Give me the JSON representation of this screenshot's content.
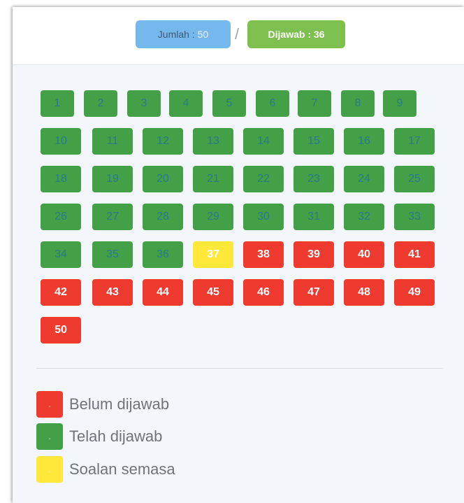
{
  "header": {
    "total_label": "Jumlah : ",
    "total_value": "50",
    "separator": "/",
    "answered_label": "Dijawab : 36"
  },
  "questions": [
    {
      "n": "1",
      "s": "answered"
    },
    {
      "n": "2",
      "s": "answered"
    },
    {
      "n": "3",
      "s": "answered"
    },
    {
      "n": "4",
      "s": "answered"
    },
    {
      "n": "5",
      "s": "answered"
    },
    {
      "n": "6",
      "s": "answered"
    },
    {
      "n": "7",
      "s": "answered"
    },
    {
      "n": "8",
      "s": "answered"
    },
    {
      "n": "9",
      "s": "answered"
    },
    {
      "n": "10",
      "s": "answered"
    },
    {
      "n": "11",
      "s": "answered"
    },
    {
      "n": "12",
      "s": "answered"
    },
    {
      "n": "13",
      "s": "answered"
    },
    {
      "n": "14",
      "s": "answered"
    },
    {
      "n": "15",
      "s": "answered"
    },
    {
      "n": "16",
      "s": "answered"
    },
    {
      "n": "17",
      "s": "answered"
    },
    {
      "n": "18",
      "s": "answered"
    },
    {
      "n": "19",
      "s": "answered"
    },
    {
      "n": "20",
      "s": "answered"
    },
    {
      "n": "21",
      "s": "answered"
    },
    {
      "n": "22",
      "s": "answered"
    },
    {
      "n": "23",
      "s": "answered"
    },
    {
      "n": "24",
      "s": "answered"
    },
    {
      "n": "25",
      "s": "answered"
    },
    {
      "n": "26",
      "s": "answered"
    },
    {
      "n": "27",
      "s": "answered"
    },
    {
      "n": "28",
      "s": "answered"
    },
    {
      "n": "29",
      "s": "answered"
    },
    {
      "n": "30",
      "s": "answered"
    },
    {
      "n": "31",
      "s": "answered"
    },
    {
      "n": "32",
      "s": "answered"
    },
    {
      "n": "33",
      "s": "answered"
    },
    {
      "n": "34",
      "s": "answered"
    },
    {
      "n": "35",
      "s": "answered"
    },
    {
      "n": "36",
      "s": "answered"
    },
    {
      "n": "37",
      "s": "current"
    },
    {
      "n": "38",
      "s": "unanswered"
    },
    {
      "n": "39",
      "s": "unanswered"
    },
    {
      "n": "40",
      "s": "unanswered"
    },
    {
      "n": "41",
      "s": "unanswered"
    },
    {
      "n": "42",
      "s": "unanswered"
    },
    {
      "n": "43",
      "s": "unanswered"
    },
    {
      "n": "44",
      "s": "unanswered"
    },
    {
      "n": "45",
      "s": "unanswered"
    },
    {
      "n": "46",
      "s": "unanswered"
    },
    {
      "n": "47",
      "s": "unanswered"
    },
    {
      "n": "48",
      "s": "unanswered"
    },
    {
      "n": "49",
      "s": "unanswered"
    },
    {
      "n": "50",
      "s": "unanswered"
    }
  ],
  "legend": [
    {
      "label": "Belum dijawab",
      "marker": ".",
      "color": "#ef3b2f"
    },
    {
      "label": "Telah dijawab",
      "marker": ".",
      "color": "#43a047"
    },
    {
      "label": "Soalan semasa",
      "marker": ".",
      "color": "#ffe83a"
    }
  ],
  "colors": {
    "answered": "#43a047",
    "unanswered": "#ef3b2f",
    "current": "#ffe83a",
    "total_pill": "#74b8ec",
    "answered_pill": "#7ec04f"
  }
}
